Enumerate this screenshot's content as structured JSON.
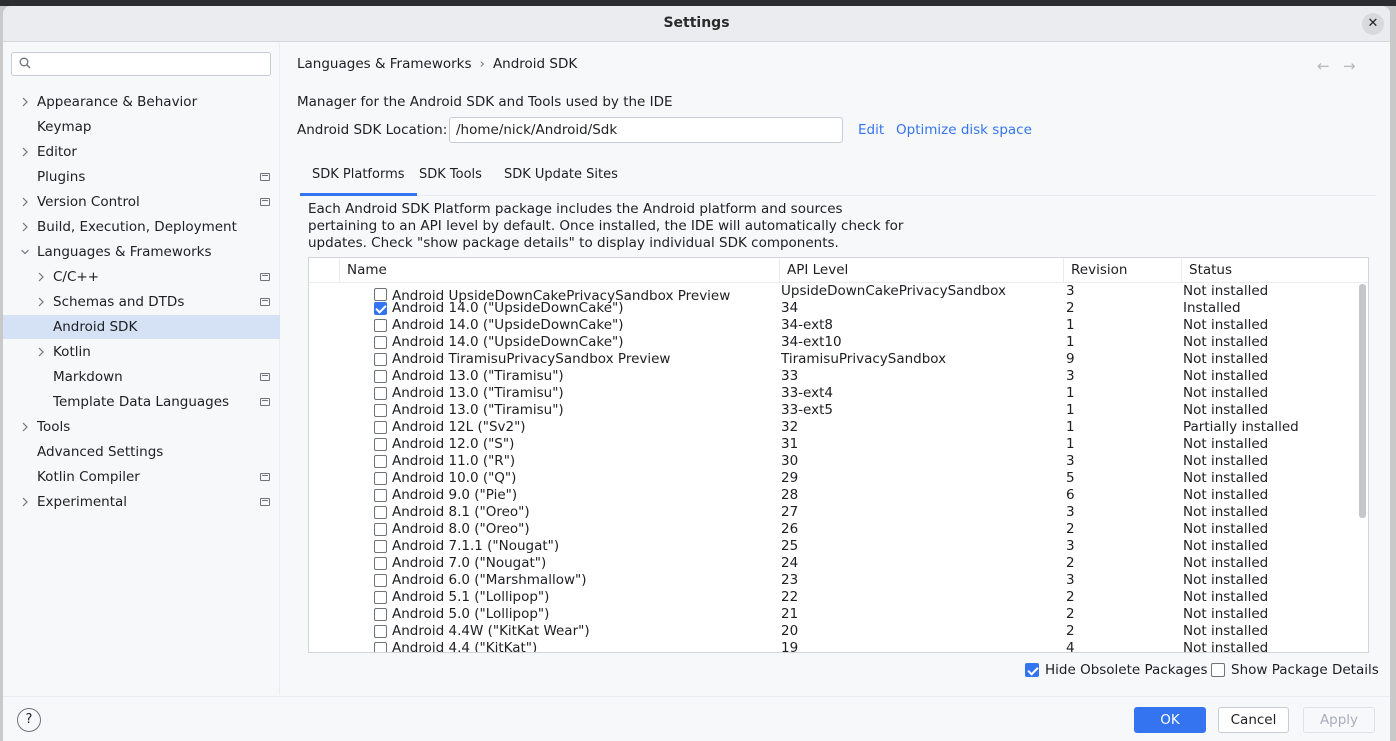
{
  "window": {
    "title": "Settings"
  },
  "sidebar": {
    "search_placeholder": "",
    "items": [
      {
        "label": "Appearance & Behavior",
        "chevron": "right",
        "indent": 0,
        "project_icon": false
      },
      {
        "label": "Keymap",
        "chevron": "none",
        "indent": 0,
        "project_icon": false
      },
      {
        "label": "Editor",
        "chevron": "right",
        "indent": 0,
        "project_icon": false
      },
      {
        "label": "Plugins",
        "chevron": "none",
        "indent": 0,
        "project_icon": true
      },
      {
        "label": "Version Control",
        "chevron": "right",
        "indent": 0,
        "project_icon": true
      },
      {
        "label": "Build, Execution, Deployment",
        "chevron": "right",
        "indent": 0,
        "project_icon": false
      },
      {
        "label": "Languages & Frameworks",
        "chevron": "down",
        "indent": 0,
        "project_icon": false
      },
      {
        "label": "C/C++",
        "chevron": "right",
        "indent": 1,
        "project_icon": true
      },
      {
        "label": "Schemas and DTDs",
        "chevron": "right",
        "indent": 1,
        "project_icon": true
      },
      {
        "label": "Android SDK",
        "chevron": "none",
        "indent": 1,
        "project_icon": false,
        "selected": true
      },
      {
        "label": "Kotlin",
        "chevron": "right",
        "indent": 1,
        "project_icon": false
      },
      {
        "label": "Markdown",
        "chevron": "none",
        "indent": 1,
        "project_icon": true
      },
      {
        "label": "Template Data Languages",
        "chevron": "none",
        "indent": 1,
        "project_icon": true
      },
      {
        "label": "Tools",
        "chevron": "right",
        "indent": 0,
        "project_icon": false
      },
      {
        "label": "Advanced Settings",
        "chevron": "none",
        "indent": 0,
        "project_icon": false
      },
      {
        "label": "Kotlin Compiler",
        "chevron": "none",
        "indent": 0,
        "project_icon": true
      },
      {
        "label": "Experimental",
        "chevron": "right",
        "indent": 0,
        "project_icon": true
      }
    ]
  },
  "breadcrumb": {
    "parent": "Languages & Frameworks",
    "separator": "›",
    "current": "Android SDK"
  },
  "nav": {
    "back": "←",
    "forward": "→"
  },
  "description": "Manager for the Android SDK and Tools used by the IDE",
  "sdk_location": {
    "label": "Android SDK Location:",
    "value": "/home/nick/Android/Sdk",
    "edit": "Edit",
    "optimize": "Optimize disk space"
  },
  "tabs": [
    "SDK Platforms",
    "SDK Tools",
    "SDK Update Sites"
  ],
  "tab_description": "Each Android SDK Platform package includes the Android platform and sources pertaining to an API level by default. Once installed, the IDE will automatically check for updates. Check \"show package details\" to display individual SDK components.",
  "table": {
    "columns": [
      "Name",
      "API Level",
      "Revision",
      "Status"
    ],
    "rows": [
      {
        "name": "Android UpsideDownCakePrivacySandbox Preview",
        "api": "UpsideDownCakePrivacySandbox",
        "revision": "3",
        "status": "Not installed",
        "checked": false
      },
      {
        "name": "Android 14.0 (\"UpsideDownCake\")",
        "api": "34",
        "revision": "2",
        "status": "Installed",
        "checked": true
      },
      {
        "name": "Android 14.0 (\"UpsideDownCake\")",
        "api": "34-ext8",
        "revision": "1",
        "status": "Not installed",
        "checked": false
      },
      {
        "name": "Android 14.0 (\"UpsideDownCake\")",
        "api": "34-ext10",
        "revision": "1",
        "status": "Not installed",
        "checked": false
      },
      {
        "name": "Android TiramisuPrivacySandbox Preview",
        "api": "TiramisuPrivacySandbox",
        "revision": "9",
        "status": "Not installed",
        "checked": false
      },
      {
        "name": "Android 13.0 (\"Tiramisu\")",
        "api": "33",
        "revision": "3",
        "status": "Not installed",
        "checked": false
      },
      {
        "name": "Android 13.0 (\"Tiramisu\")",
        "api": "33-ext4",
        "revision": "1",
        "status": "Not installed",
        "checked": false
      },
      {
        "name": "Android 13.0 (\"Tiramisu\")",
        "api": "33-ext5",
        "revision": "1",
        "status": "Not installed",
        "checked": false
      },
      {
        "name": "Android 12L (\"Sv2\")",
        "api": "32",
        "revision": "1",
        "status": "Partially installed",
        "checked": false
      },
      {
        "name": "Android 12.0 (\"S\")",
        "api": "31",
        "revision": "1",
        "status": "Not installed",
        "checked": false
      },
      {
        "name": "Android 11.0 (\"R\")",
        "api": "30",
        "revision": "3",
        "status": "Not installed",
        "checked": false
      },
      {
        "name": "Android 10.0 (\"Q\")",
        "api": "29",
        "revision": "5",
        "status": "Not installed",
        "checked": false
      },
      {
        "name": "Android 9.0 (\"Pie\")",
        "api": "28",
        "revision": "6",
        "status": "Not installed",
        "checked": false
      },
      {
        "name": "Android 8.1 (\"Oreo\")",
        "api": "27",
        "revision": "3",
        "status": "Not installed",
        "checked": false
      },
      {
        "name": "Android 8.0 (\"Oreo\")",
        "api": "26",
        "revision": "2",
        "status": "Not installed",
        "checked": false
      },
      {
        "name": "Android 7.1.1 (\"Nougat\")",
        "api": "25",
        "revision": "3",
        "status": "Not installed",
        "checked": false
      },
      {
        "name": "Android 7.0 (\"Nougat\")",
        "api": "24",
        "revision": "2",
        "status": "Not installed",
        "checked": false
      },
      {
        "name": "Android 6.0 (\"Marshmallow\")",
        "api": "23",
        "revision": "3",
        "status": "Not installed",
        "checked": false
      },
      {
        "name": "Android 5.1 (\"Lollipop\")",
        "api": "22",
        "revision": "2",
        "status": "Not installed",
        "checked": false
      },
      {
        "name": "Android 5.0 (\"Lollipop\")",
        "api": "21",
        "revision": "2",
        "status": "Not installed",
        "checked": false
      },
      {
        "name": "Android 4.4W (\"KitKat Wear\")",
        "api": "20",
        "revision": "2",
        "status": "Not installed",
        "checked": false
      },
      {
        "name": "Android 4.4 (\"KitKat\")",
        "api": "19",
        "revision": "4",
        "status": "Not installed",
        "checked": false
      }
    ]
  },
  "options": {
    "hide_obsolete": {
      "label": "Hide Obsolete Packages",
      "checked": true
    },
    "show_details": {
      "label": "Show Package Details",
      "checked": false
    }
  },
  "footer": {
    "help": "?",
    "ok": "OK",
    "cancel": "Cancel",
    "apply": "Apply"
  },
  "colors": {
    "accent": "#3574f0",
    "selection": "#d5e1f5",
    "background": "#f7f8fa"
  }
}
